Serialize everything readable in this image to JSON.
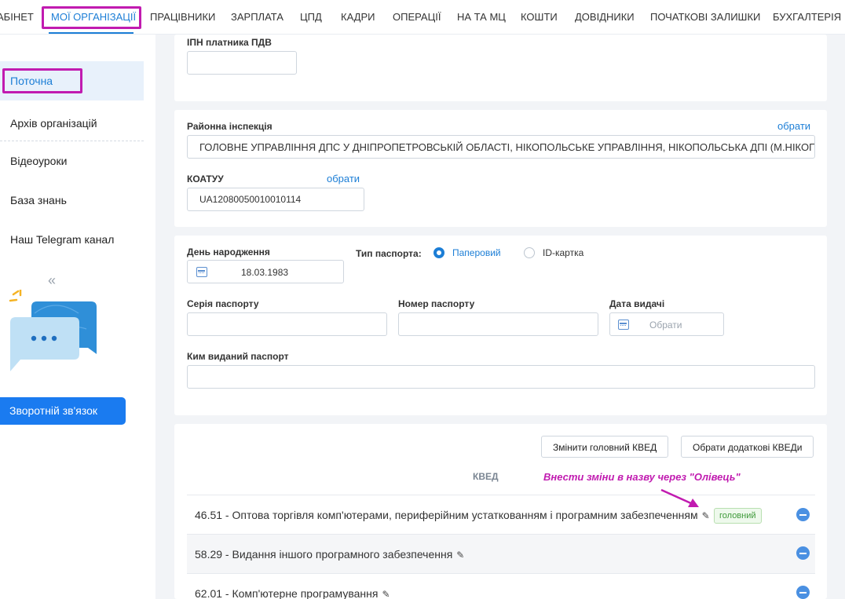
{
  "nav": {
    "items": [
      "АБІНЕТ",
      "МОЇ ОРГАНІЗАЦІЇ",
      "ПРАЦІВНИКИ",
      "ЗАРПЛАТА",
      "ЦПД",
      "КАДРИ",
      "ОПЕРАЦІЇ",
      "НА та МЦ",
      "КОШТИ",
      "ДОВІДНИКИ",
      "ПОЧАТКОВІ ЗАЛИШКИ",
      "БУХГАЛТЕРІЯ"
    ],
    "active": "МОЇ ОРГАНІЗАЦІЇ"
  },
  "sidebar": {
    "items": [
      "Поточна",
      "Архів організацій",
      "Відеоуроки",
      "База знань",
      "Наш Telegram канал"
    ],
    "active": "Поточна",
    "feedback_button": "Зворотній зв'язок"
  },
  "vat": {
    "label": "ІПН платника ПДВ",
    "value": ""
  },
  "inspection": {
    "label": "Районна інспекція",
    "choose_link": "обрати",
    "value": "ГОЛОВНЕ УПРАВЛІННЯ ДПС У ДНІПРОПЕТРОВСЬКІЙ ОБЛАСТІ, НІКОПОЛЬСЬКЕ УПРАВЛІННЯ, НІКОПОЛЬСЬКА ДПІ (М.НІКОПОЛЬ)"
  },
  "koatuu": {
    "label": "КОАТУУ",
    "choose_link": "обрати",
    "value": "UA12080050010010114"
  },
  "person": {
    "birthday_label": "День народження",
    "birthday_value": "18.03.1983",
    "passport_type_label": "Тип паспорта:",
    "passport_types": [
      "Паперовий",
      "ID-картка"
    ],
    "passport_type_selected": "Паперовий",
    "series_label": "Серія паспорту",
    "number_label": "Номер паспорту",
    "issue_date_label": "Дата видачі",
    "issue_date_placeholder": "Обрати",
    "issued_by_label": "Ким виданий паспорт"
  },
  "kved": {
    "change_main_button": "Змінити головний КВЕД",
    "choose_additional_button": "Обрати додаткові КВЕДи",
    "column_header": "КВЕД",
    "main_badge": "головний",
    "rows": [
      "46.51 - Оптова торгівля комп'ютерами, периферійним устаткованням і програмним забезпеченням",
      "58.29 - Видання іншого програмного забезпечення",
      "62.01 - Комп'ютерне програмування"
    ]
  },
  "annotation": {
    "text": "Внести зміни в назву через \"Олівець\"",
    "color": "#c11bb0"
  },
  "colors": {
    "accent": "#1c7ed6",
    "highlight": "#c11bb0"
  }
}
